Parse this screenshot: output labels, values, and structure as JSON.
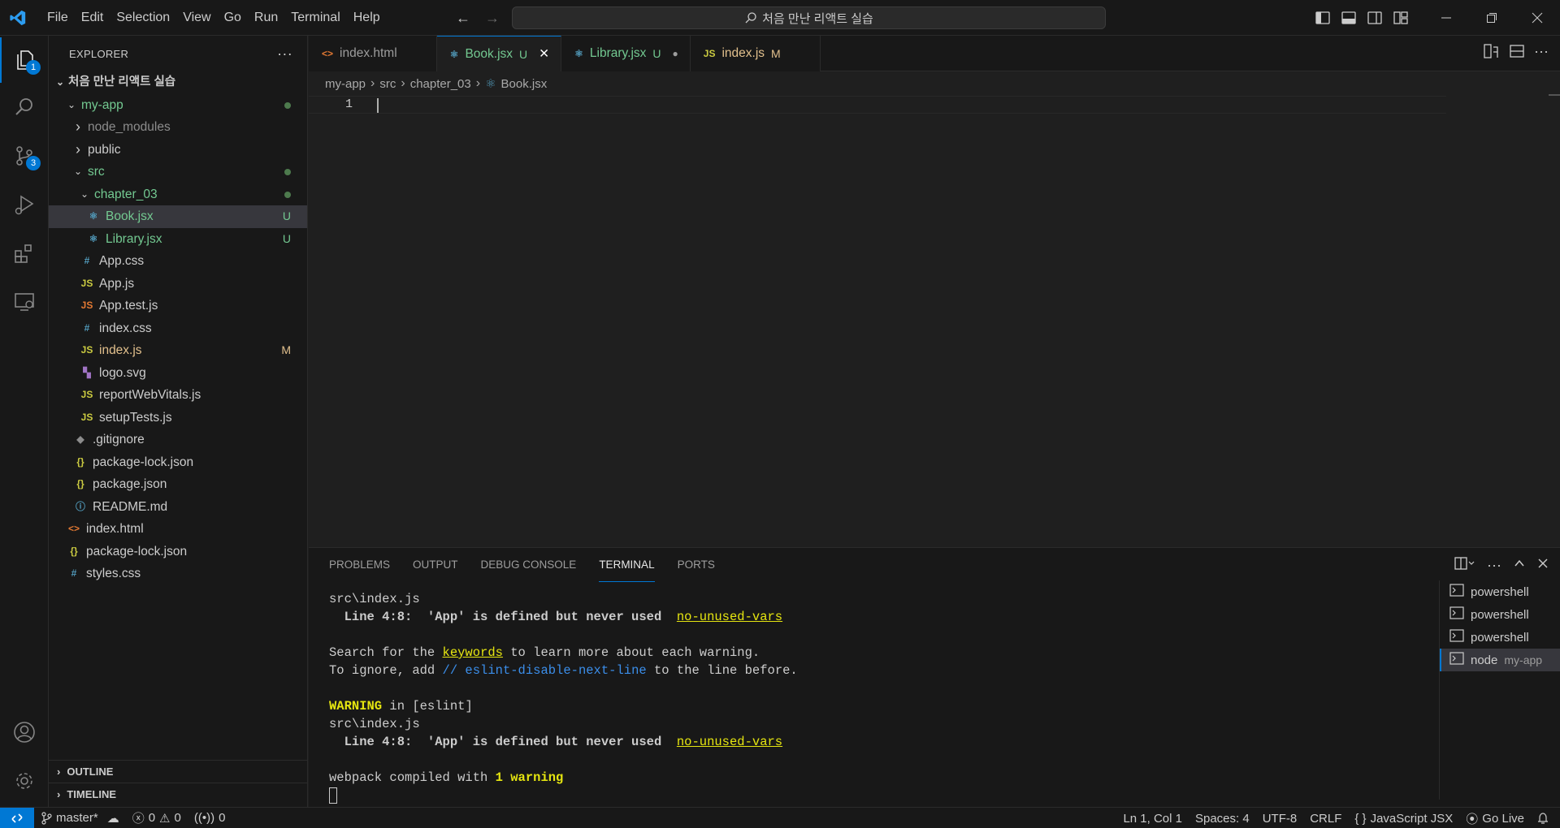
{
  "menu": [
    "File",
    "Edit",
    "Selection",
    "View",
    "Go",
    "Run",
    "Terminal",
    "Help"
  ],
  "search_text": "처음 만난 리액트 실습",
  "activity": {
    "explorer_badge": "1",
    "scm_badge": "3"
  },
  "explorer": {
    "title": "EXPLORER",
    "workspace": "처음 만난 리액트 실습",
    "tree": [
      {
        "label": "my-app",
        "indent": 0,
        "kind": "folder",
        "open": true,
        "color": "green",
        "dot": true
      },
      {
        "label": "node_modules",
        "indent": 1,
        "kind": "folder",
        "open": false,
        "color": "grey"
      },
      {
        "label": "public",
        "indent": 1,
        "kind": "folder",
        "open": false,
        "color": "normal"
      },
      {
        "label": "src",
        "indent": 1,
        "kind": "folder",
        "open": true,
        "color": "green",
        "dot": true
      },
      {
        "label": "chapter_03",
        "indent": 2,
        "kind": "folder",
        "open": true,
        "color": "green",
        "dot": true
      },
      {
        "label": "Book.jsx",
        "indent": 3,
        "kind": "react",
        "color": "green",
        "deco": "U",
        "selected": true
      },
      {
        "label": "Library.jsx",
        "indent": 3,
        "kind": "react",
        "color": "green",
        "deco": "U"
      },
      {
        "label": "App.css",
        "indent": 2,
        "kind": "css",
        "color": "normal"
      },
      {
        "label": "App.js",
        "indent": 2,
        "kind": "js",
        "color": "normal"
      },
      {
        "label": "App.test.js",
        "indent": 2,
        "kind": "jstest",
        "color": "normal"
      },
      {
        "label": "index.css",
        "indent": 2,
        "kind": "css",
        "color": "normal"
      },
      {
        "label": "index.js",
        "indent": 2,
        "kind": "js",
        "color": "mod",
        "deco": "M"
      },
      {
        "label": "logo.svg",
        "indent": 2,
        "kind": "svg",
        "color": "normal"
      },
      {
        "label": "reportWebVitals.js",
        "indent": 2,
        "kind": "js",
        "color": "normal"
      },
      {
        "label": "setupTests.js",
        "indent": 2,
        "kind": "js",
        "color": "normal"
      },
      {
        "label": ".gitignore",
        "indent": 1,
        "kind": "git",
        "color": "normal"
      },
      {
        "label": "package-lock.json",
        "indent": 1,
        "kind": "json",
        "color": "normal"
      },
      {
        "label": "package.json",
        "indent": 1,
        "kind": "json",
        "color": "normal"
      },
      {
        "label": "README.md",
        "indent": 1,
        "kind": "info",
        "color": "normal"
      },
      {
        "label": "index.html",
        "indent": 0,
        "kind": "html",
        "color": "normal"
      },
      {
        "label": "package-lock.json",
        "indent": 0,
        "kind": "json",
        "color": "normal"
      },
      {
        "label": "styles.css",
        "indent": 0,
        "kind": "css",
        "color": "normal"
      }
    ],
    "outline": "OUTLINE",
    "timeline": "TIMELINE"
  },
  "tabs": [
    {
      "label": "index.html",
      "kind": "html",
      "deco": "",
      "active": false,
      "color": "normal"
    },
    {
      "label": "Book.jsx",
      "kind": "react",
      "deco": "U",
      "active": true,
      "color": "green",
      "close": "✕"
    },
    {
      "label": "Library.jsx",
      "kind": "react",
      "deco": "U",
      "active": false,
      "color": "green",
      "dirty": "●"
    },
    {
      "label": "index.js",
      "kind": "js",
      "deco": "M",
      "active": false,
      "color": "mod"
    }
  ],
  "breadcrumb": [
    "my-app",
    "src",
    "chapter_03",
    "Book.jsx"
  ],
  "editor": {
    "line_number": "1"
  },
  "panel": {
    "tabs": [
      "PROBLEMS",
      "OUTPUT",
      "DEBUG CONSOLE",
      "TERMINAL",
      "PORTS"
    ],
    "active_tab": "TERMINAL",
    "terminal": {
      "l1": "src\\index.js",
      "l2a": "  Line 4:8:  'App' is defined but never used  ",
      "l2b": "no-unused-vars",
      "l4a": "Search for the ",
      "l4b": "keywords",
      "l4c": " to learn more about each warning.",
      "l5a": "To ignore, add ",
      "l5b": "// eslint-disable-next-line",
      "l5c": " to the line before.",
      "l7a": "WARNING",
      "l7b": " in [eslint]",
      "l8": "src\\index.js",
      "l9a": "  Line 4:8:  'App' is defined but never used  ",
      "l9b": "no-unused-vars",
      "l11a": "webpack compiled with ",
      "l11b": "1 warning"
    },
    "terminals": [
      {
        "name": "powershell",
        "sub": ""
      },
      {
        "name": "powershell",
        "sub": ""
      },
      {
        "name": "powershell",
        "sub": ""
      },
      {
        "name": "node",
        "sub": "my-app",
        "active": true
      }
    ]
  },
  "status": {
    "branch": "master*",
    "errors": "0",
    "warnings": "0",
    "ports": "0",
    "position": "Ln 1, Col 1",
    "spaces": "Spaces: 4",
    "encoding": "UTF-8",
    "eol": "CRLF",
    "language": "JavaScript JSX",
    "golive": "Go Live"
  },
  "colors": {
    "accent": "#0078d4",
    "untracked": "#73c991",
    "modified": "#e2c08d"
  }
}
